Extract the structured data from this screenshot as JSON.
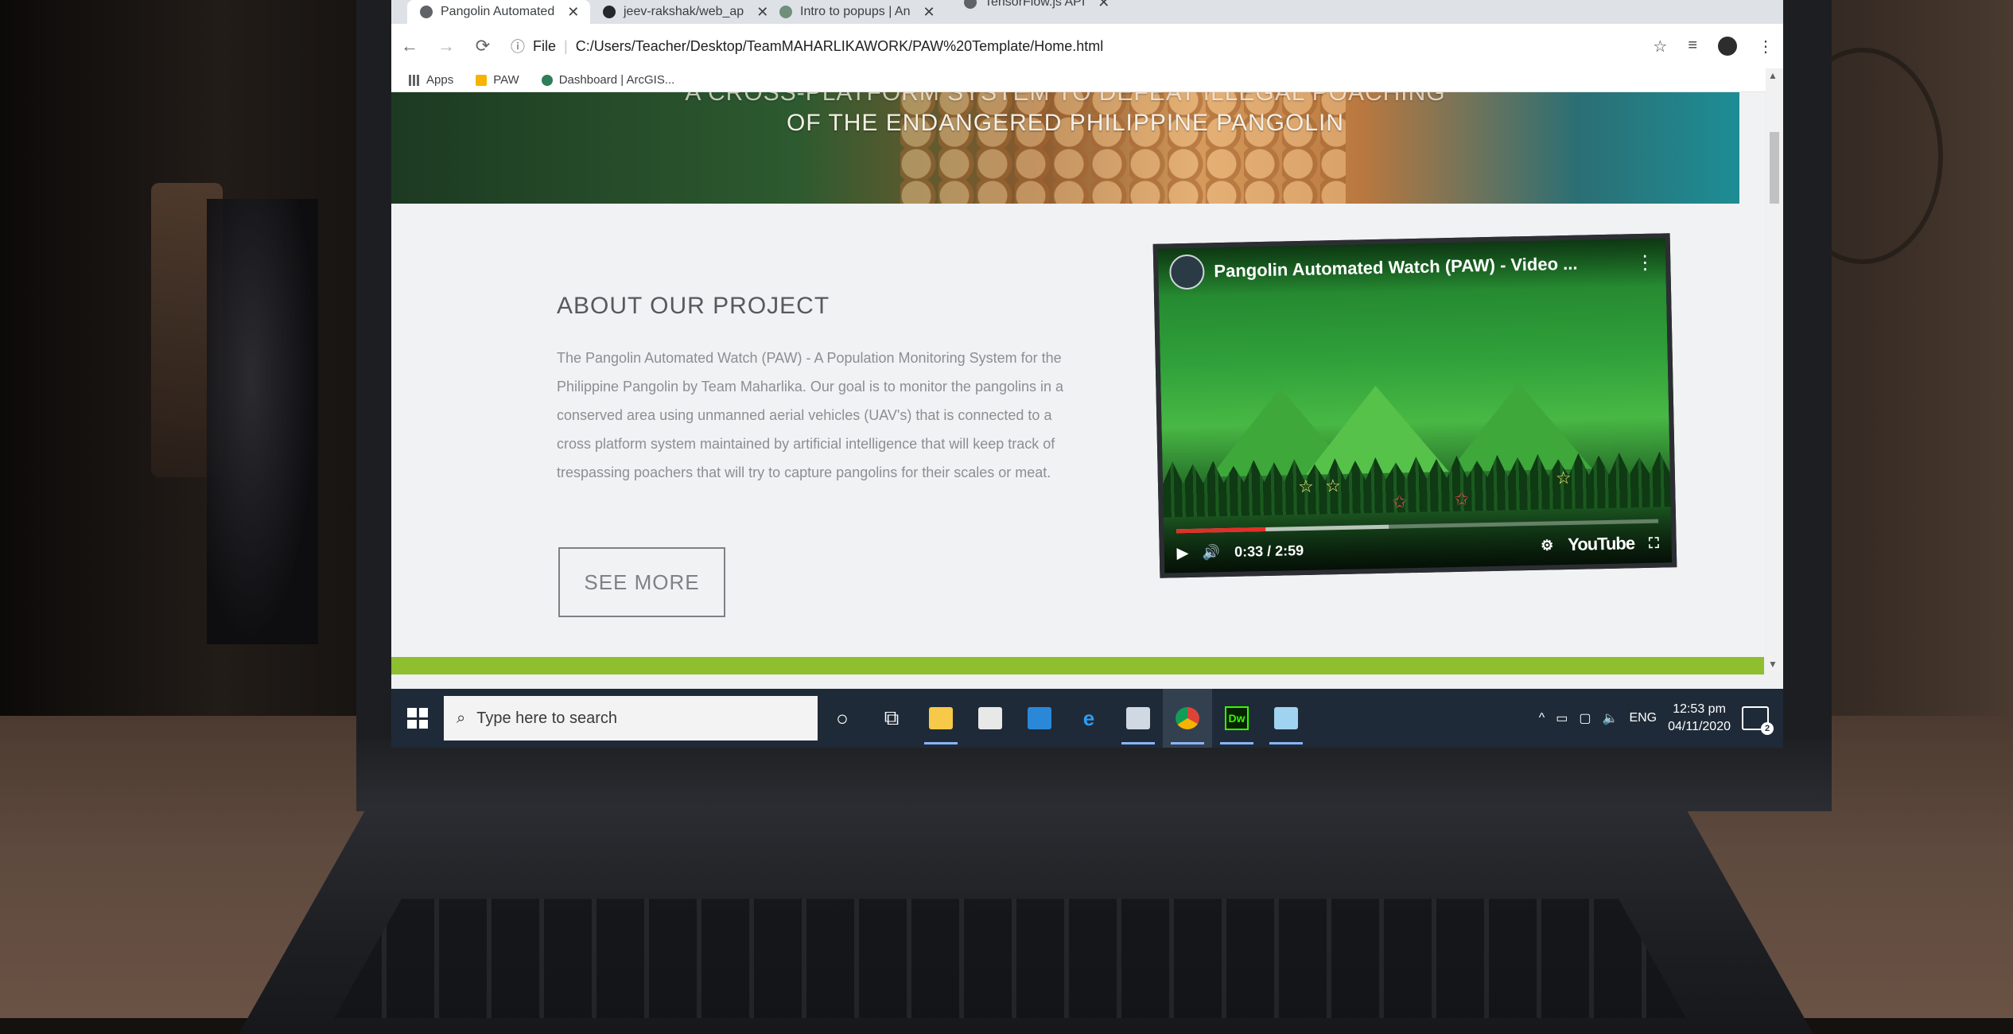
{
  "browser": {
    "tabs": [
      {
        "label": "Pangolin Automated",
        "active": true
      },
      {
        "label": "jeev-rakshak/web_ap",
        "active": false
      },
      {
        "label": "Intro to popups | An",
        "active": false
      },
      {
        "label": "TensorFlow.js API",
        "active": false
      }
    ],
    "address": {
      "scheme_label": "File",
      "url": "C:/Users/Teacher/Desktop/TeamMAHARLIKAWORK/PAW%20Template/Home.html"
    },
    "bookmarks": [
      "Apps",
      "PAW",
      "Dashboard | ArcGIS..."
    ]
  },
  "page": {
    "hero": {
      "line1": "A CROSS-PLATFORM SYSTEM TO DEFEAT ILLEGAL POACHING",
      "line2": "OF THE ENDANGERED PHILIPPINE PANGOLIN"
    },
    "about": {
      "title": "ABOUT OUR PROJECT",
      "body": "The Pangolin Automated Watch (PAW) - A Population Monitoring System for the Philippine Pangolin by Team Maharlika. Our goal is to monitor the pangolins in a conserved area using unmanned aerial vehicles (UAV's) that is connected to a cross platform system maintained by artificial intelligence that will keep track of trespassing poachers that will try to capture pangolins for their scales or meat.",
      "button": "SEE MORE"
    },
    "video": {
      "title": "Pangolin Automated Watch (PAW) - Video ...",
      "time": "0:33 / 2:59",
      "progress": 0.184,
      "buffered": 0.44,
      "brand": "YouTube"
    },
    "colors": {
      "accent_strip": "#8dbf2e",
      "progress": "#e52d27",
      "taskbar": "#1f2a38"
    }
  },
  "taskbar": {
    "search_placeholder": "Type here to search",
    "apps": [
      "cortana-icon",
      "task-view-icon",
      "file-explorer-icon",
      "store-icon",
      "mail-icon",
      "edge-icon",
      "app-icon",
      "chrome-icon",
      "dreamweaver-icon",
      "notes-icon"
    ],
    "dreamweaver_label": "Dw",
    "language": "ENG",
    "time": "12:53 pm",
    "date": "04/11/2020",
    "notifications": "2"
  }
}
